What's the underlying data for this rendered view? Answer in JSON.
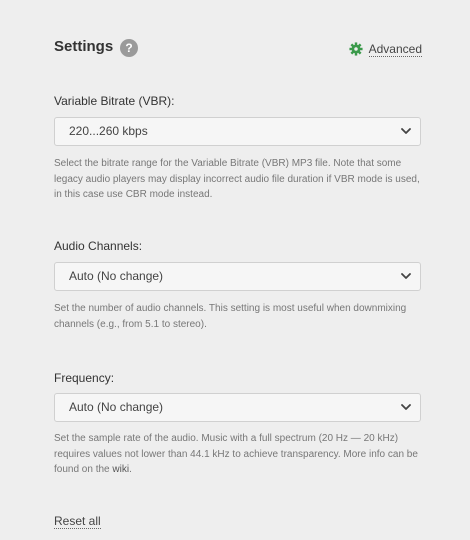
{
  "header": {
    "title": "Settings",
    "help_icon": "question-circle-icon",
    "help_glyph": "?",
    "advanced_label": "Advanced",
    "advanced_icon": "gear-icon"
  },
  "fields": [
    {
      "label": "Variable Bitrate (VBR):",
      "value": "220...260 kbps",
      "help": "Select the bitrate range for the Variable Bitrate (VBR) MP3 file. Note that some legacy audio players may display incorrect audio file duration if VBR mode is used, in this case use CBR mode instead."
    },
    {
      "label": "Audio Channels:",
      "value": "Auto (No change)",
      "help": "Set the number of audio channels. This setting is most useful when downmixing channels (e.g., from 5.1 to stereo)."
    },
    {
      "label": "Frequency:",
      "value": "Auto (No change)",
      "help_main": "Set the sample rate of the audio. Music with a full spectrum (20 Hz — 20 kHz) requires values not lower than 44.1 kHz to achieve transparency. More info can be found on the ",
      "help_link": "wiki",
      "help_end": "."
    }
  ],
  "footer": {
    "reset_label": "Reset all"
  },
  "colors": {
    "background": "#eeeeee",
    "accent_green": "#3a9a4a",
    "help_icon_bg": "#9a9a9a",
    "select_bg": "#f6f6f6"
  }
}
